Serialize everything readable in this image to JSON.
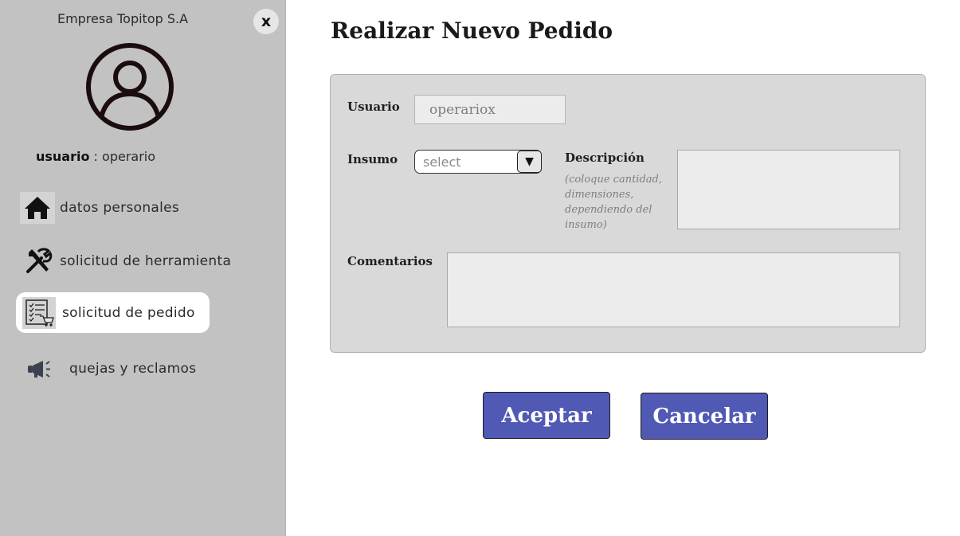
{
  "sidebar": {
    "company": "Empresa Topitop S.A",
    "close_label": "x",
    "user_label": "usuario",
    "user_separator": " : ",
    "user_value": "operario",
    "items": [
      {
        "label": "datos personales",
        "icon": "home-icon"
      },
      {
        "label": "solicitud de herramienta",
        "icon": "tools-icon"
      },
      {
        "label": "solicitud de pedido",
        "icon": "order-list-cart-icon",
        "active": true
      },
      {
        "label": "quejas y reclamos",
        "icon": "megaphone-icon"
      }
    ]
  },
  "main": {
    "title": "Realizar Nuevo Pedido",
    "form": {
      "usuario_label": "Usuario",
      "usuario_value": "operariox",
      "insumo_label": "Insumo",
      "insumo_selected": "select",
      "descripcion_label": "Descripción",
      "descripcion_hint": "(coloque cantidad, dimensiones, dependiendo del insumo)",
      "descripcion_value": "",
      "comentarios_label": "Comentarios",
      "comentarios_value": ""
    },
    "buttons": {
      "accept": "Aceptar",
      "cancel": "Cancelar"
    }
  },
  "colors": {
    "sidebar_bg": "#c2c2c2",
    "panel_bg": "#d9d9d9",
    "button_bg": "#5059b4"
  }
}
